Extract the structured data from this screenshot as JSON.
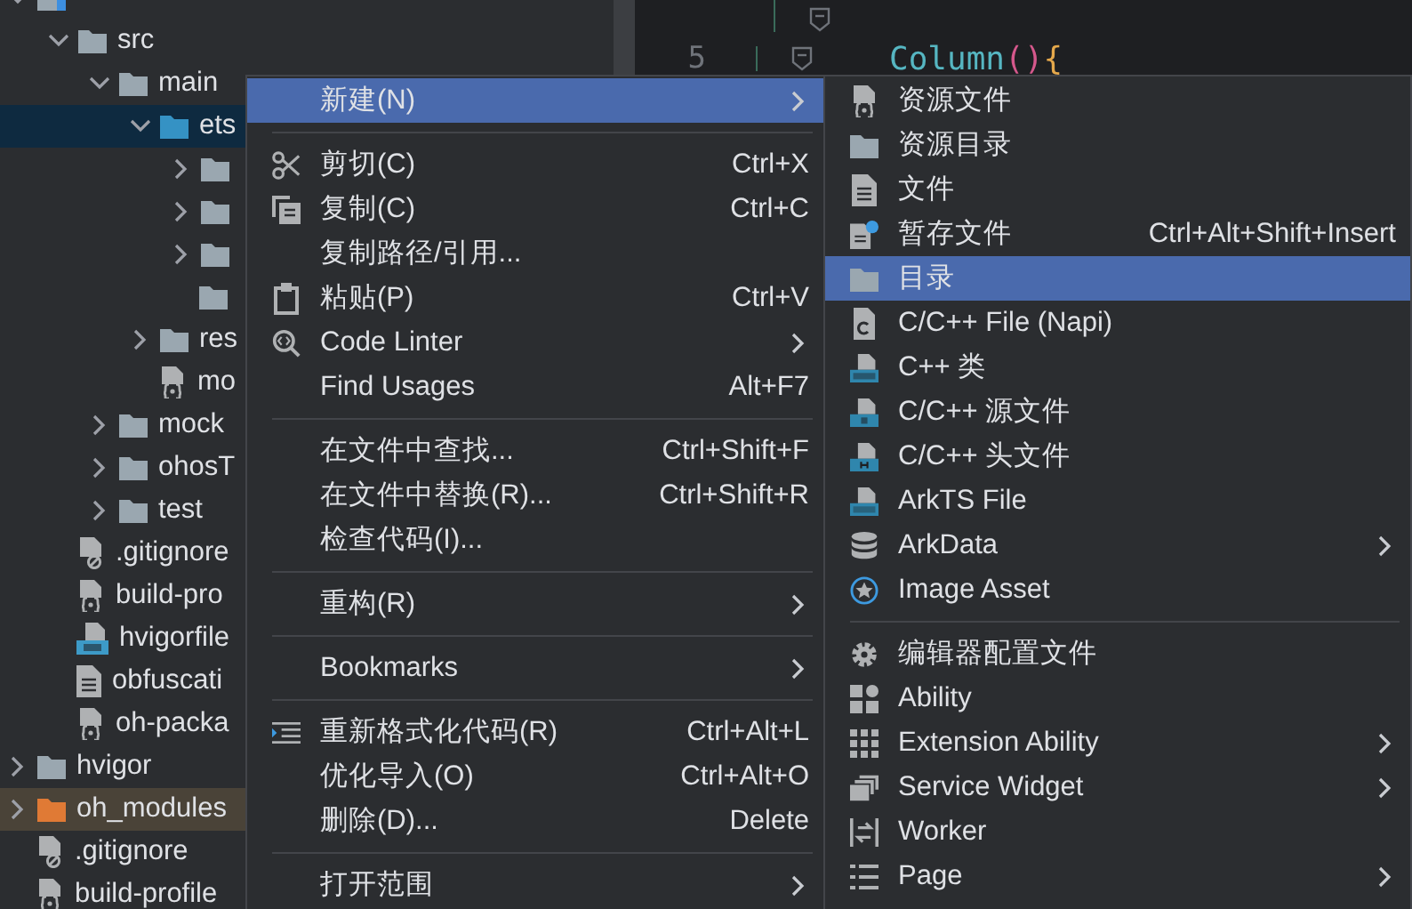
{
  "project_tree": [
    {
      "kind": "module",
      "expanded": true,
      "selected": false,
      "children": [
        {
          "label": "src",
          "kind": "folder",
          "expanded": true,
          "selected": false,
          "children": [
            {
              "label": "main",
              "kind": "folder",
              "expanded": true,
              "selected": false,
              "children": [
                {
                  "label": "ets",
                  "kind": "source-folder",
                  "expanded": true,
                  "selected": true,
                  "children": [
                    {
                      "kind": "folder",
                      "expanded": false,
                      "selected": false
                    },
                    {
                      "kind": "folder",
                      "expanded": false,
                      "selected": false
                    },
                    {
                      "kind": "folder",
                      "expanded": false,
                      "selected": false
                    },
                    {
                      "kind": "folder",
                      "selected": false
                    }
                  ]
                },
                {
                  "label": "res",
                  "kind": "folder",
                  "expanded": false,
                  "selected": false
                },
                {
                  "label": "mo",
                  "kind": "config-file",
                  "selected": false
                }
              ]
            },
            {
              "label": "mock",
              "kind": "folder",
              "expanded": false,
              "selected": false
            },
            {
              "label": "ohosT",
              "kind": "folder",
              "expanded": false,
              "selected": false
            },
            {
              "label": "test",
              "kind": "folder",
              "expanded": false,
              "selected": false
            }
          ]
        },
        {
          "label": ".gitignore",
          "kind": "ignore-file",
          "selected": false
        },
        {
          "label": "build-pro",
          "kind": "config-file",
          "selected": false
        },
        {
          "label": "hvigorfile",
          "kind": "ts-file",
          "selected": false
        },
        {
          "label": "obfuscati",
          "kind": "text-file",
          "selected": false
        },
        {
          "label": "oh-packa",
          "kind": "config-file",
          "selected": false
        }
      ]
    },
    {
      "label": "hvigor",
      "kind": "folder",
      "expanded": false,
      "selected": false
    },
    {
      "label": "oh_modules",
      "kind": "excluded-folder",
      "expanded": false,
      "selected": false
    },
    {
      "label": ".gitignore",
      "kind": "ignore-file",
      "selected": false
    },
    {
      "label": "build-profile",
      "kind": "config-file",
      "selected": false
    }
  ],
  "editor": {
    "lines": [
      {
        "number": "5",
        "tokens": [
          {
            "text": "Column",
            "kind": "function"
          },
          {
            "text": "()",
            "kind": "paren"
          },
          {
            "text": "{",
            "kind": "brace"
          }
        ]
      }
    ]
  },
  "context_menu": {
    "items": [
      {
        "kind": "plain",
        "label": "新建(N)",
        "submenu": true,
        "selected": true
      },
      {
        "kind": "separator"
      },
      {
        "kind": "scissors",
        "label": "剪切(C)",
        "shortcut": "Ctrl+X",
        "submenu": false,
        "selected": false
      },
      {
        "kind": "copy",
        "label": "复制(C)",
        "shortcut": "Ctrl+C",
        "submenu": false,
        "selected": false
      },
      {
        "kind": "plain",
        "label": "复制路径/引用...",
        "submenu": false,
        "selected": false
      },
      {
        "kind": "clipboard",
        "label": "粘贴(P)",
        "shortcut": "Ctrl+V",
        "submenu": false,
        "selected": false
      },
      {
        "kind": "code-search",
        "label": "Code Linter",
        "submenu": true,
        "selected": false
      },
      {
        "kind": "plain",
        "label": "Find Usages",
        "shortcut": "Alt+F7",
        "submenu": false,
        "selected": false
      },
      {
        "kind": "separator"
      },
      {
        "kind": "plain",
        "label": "在文件中查找...",
        "shortcut": "Ctrl+Shift+F",
        "submenu": false,
        "selected": false
      },
      {
        "kind": "plain",
        "label": "在文件中替换(R)...",
        "shortcut": "Ctrl+Shift+R",
        "submenu": false,
        "selected": false
      },
      {
        "kind": "plain",
        "label": "检查代码(I)...",
        "submenu": false,
        "selected": false
      },
      {
        "kind": "separator"
      },
      {
        "kind": "plain",
        "label": "重构(R)",
        "submenu": true,
        "selected": false
      },
      {
        "kind": "separator"
      },
      {
        "kind": "plain",
        "label": "Bookmarks",
        "submenu": true,
        "selected": false
      },
      {
        "kind": "separator"
      },
      {
        "kind": "indent",
        "label": "重新格式化代码(R)",
        "shortcut": "Ctrl+Alt+L",
        "submenu": false,
        "selected": false
      },
      {
        "kind": "plain",
        "label": "优化导入(O)",
        "shortcut": "Ctrl+Alt+O",
        "submenu": false,
        "selected": false
      },
      {
        "kind": "plain",
        "label": "删除(D)...",
        "shortcut": "Delete",
        "submenu": false,
        "selected": false
      },
      {
        "kind": "separator"
      },
      {
        "kind": "plain",
        "label": "打开范围",
        "submenu": true,
        "selected": false
      }
    ]
  },
  "new_submenu": {
    "items": [
      {
        "kind": "config-file",
        "label": "资源文件",
        "submenu": false,
        "selected": false
      },
      {
        "kind": "folder",
        "label": "资源目录",
        "submenu": false,
        "selected": false
      },
      {
        "kind": "text-file",
        "label": "文件",
        "submenu": false,
        "selected": false
      },
      {
        "kind": "scratch-file",
        "label": "暂存文件",
        "shortcut": "Ctrl+Alt+Shift+Insert",
        "submenu": false,
        "selected": false
      },
      {
        "kind": "folder",
        "label": "目录",
        "submenu": false,
        "selected": true
      },
      {
        "kind": "c-doc",
        "label": "C/C++ File (Napi)",
        "submenu": false,
        "selected": false
      },
      {
        "kind": "cpp-file",
        "label": "C++ 类",
        "submenu": false,
        "selected": false
      },
      {
        "kind": "c-file",
        "label": "C/C++ 源文件",
        "submenu": false,
        "selected": false
      },
      {
        "kind": "h-file",
        "label": "C/C++ 头文件",
        "submenu": false,
        "selected": false
      },
      {
        "kind": "ets-file",
        "label": "ArkTS File",
        "submenu": false,
        "selected": false
      },
      {
        "kind": "database",
        "label": "ArkData",
        "submenu": true,
        "selected": false
      },
      {
        "kind": "star-circle",
        "label": "Image Asset",
        "submenu": false,
        "selected": false
      },
      {
        "kind": "separator"
      },
      {
        "kind": "gear",
        "label": "编辑器配置文件",
        "submenu": false,
        "selected": false
      },
      {
        "kind": "tiles",
        "label": "Ability",
        "submenu": false,
        "selected": false
      },
      {
        "kind": "dots-grid",
        "label": "Extension Ability",
        "submenu": true,
        "selected": false
      },
      {
        "kind": "stacked-windows",
        "label": "Service Widget",
        "submenu": true,
        "selected": false
      },
      {
        "kind": "swap",
        "label": "Worker",
        "submenu": false,
        "selected": false
      },
      {
        "kind": "list",
        "label": "Page",
        "submenu": true,
        "selected": false
      }
    ]
  }
}
